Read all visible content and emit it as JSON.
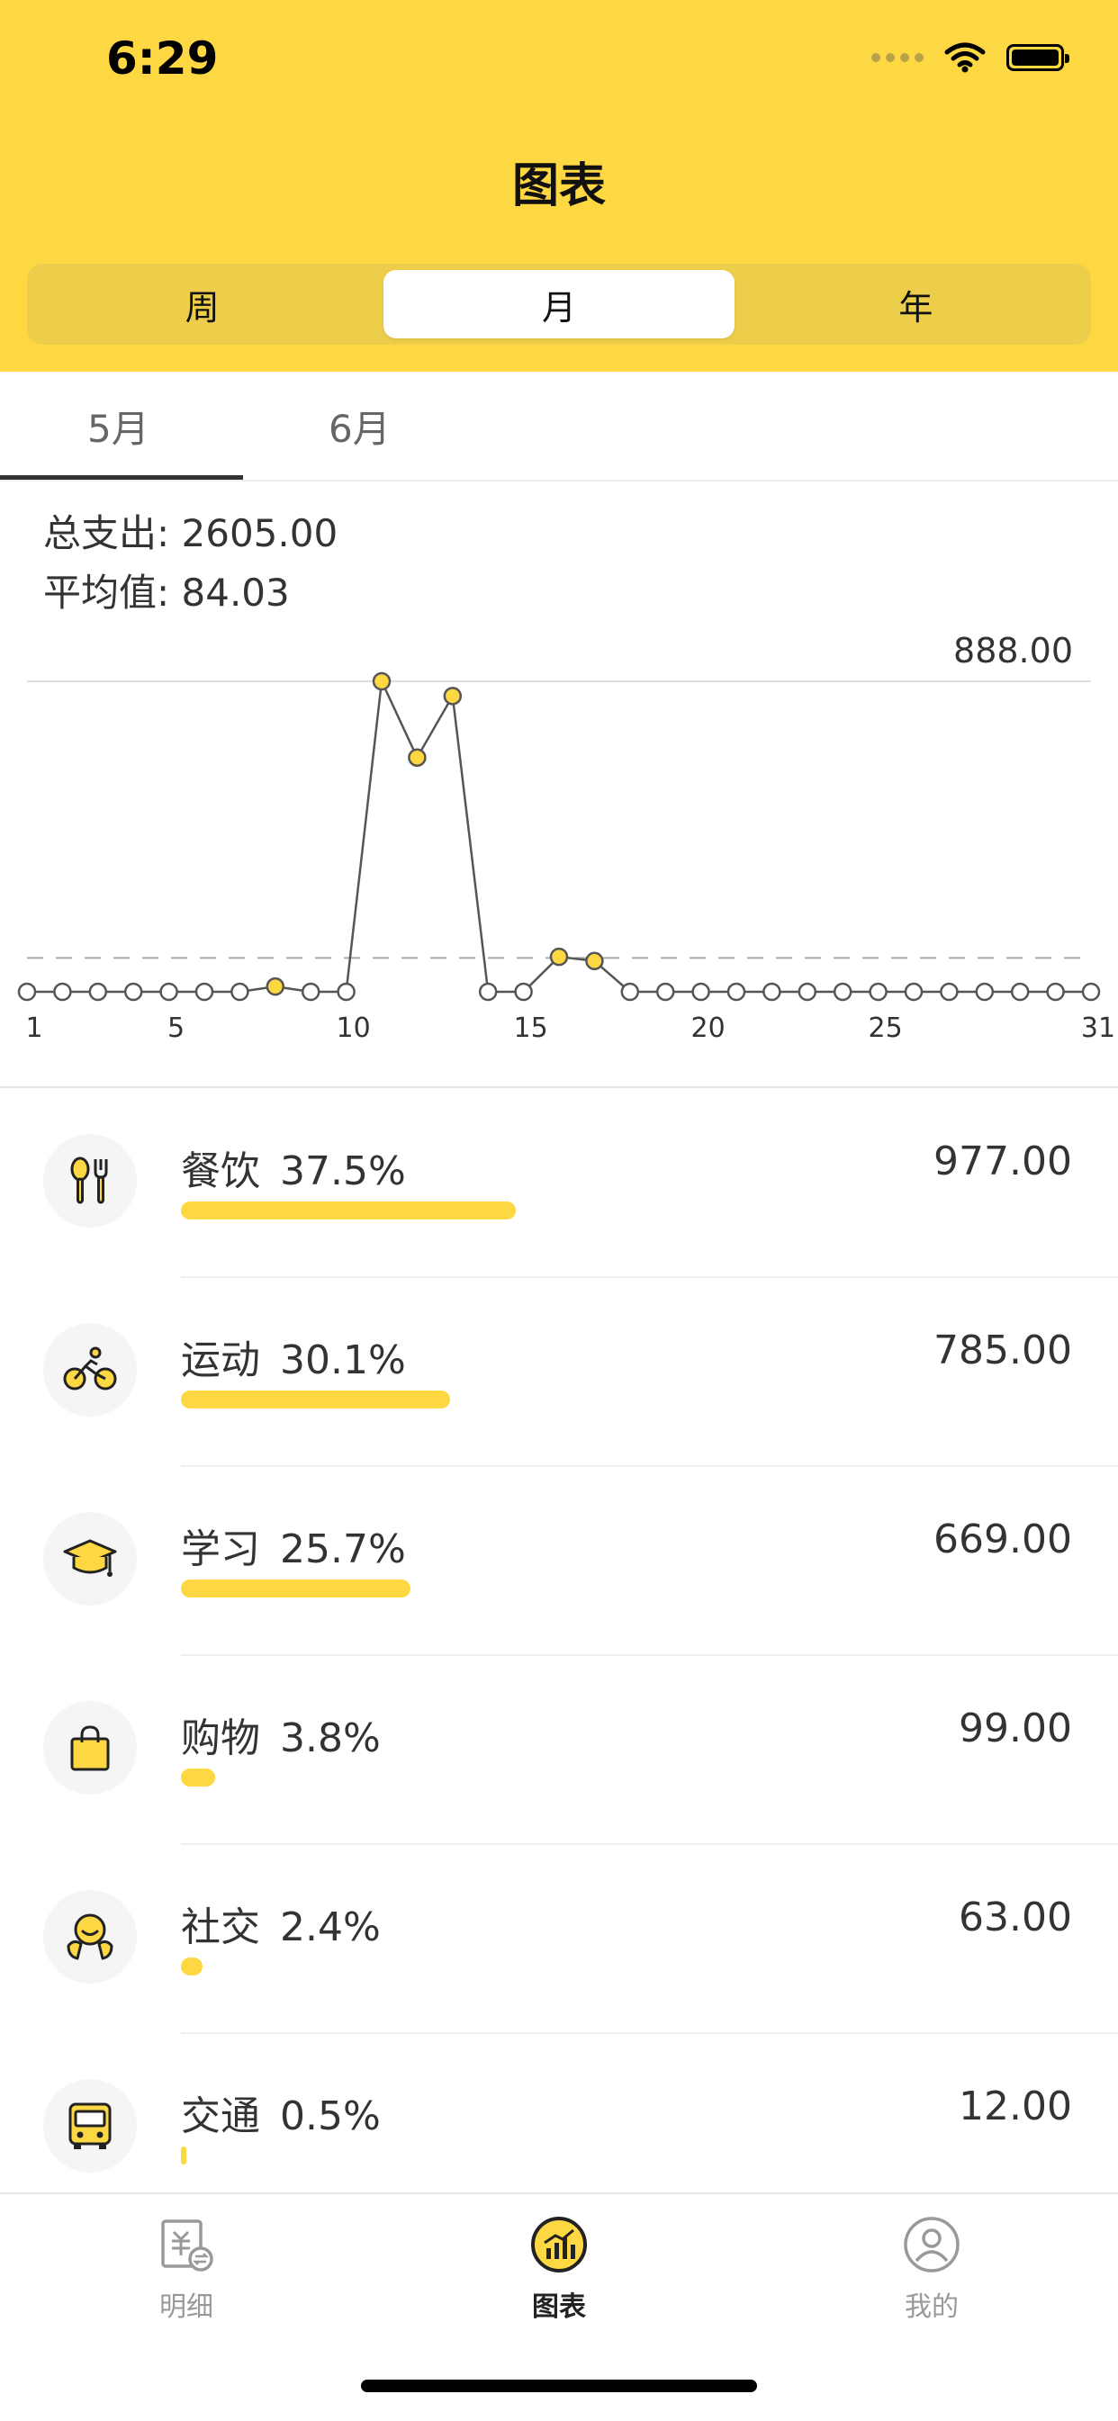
{
  "status": {
    "time": "6:29"
  },
  "header": {
    "title": "图表"
  },
  "segments": [
    {
      "label": "周"
    },
    {
      "label": "月"
    },
    {
      "label": "年"
    }
  ],
  "month_tabs": [
    {
      "label": "5月"
    },
    {
      "label": "6月"
    }
  ],
  "summary": {
    "total_label": "总支出:",
    "total_value": "2605.00",
    "avg_label": "平均值:",
    "avg_value": "84.03"
  },
  "chart_data": {
    "type": "line",
    "x": [
      1,
      2,
      3,
      4,
      5,
      6,
      7,
      8,
      9,
      10,
      11,
      12,
      13,
      14,
      15,
      16,
      17,
      18,
      19,
      20,
      21,
      22,
      23,
      24,
      25,
      26,
      27,
      28,
      29,
      30,
      31
    ],
    "y": [
      0,
      0,
      0,
      0,
      0,
      0,
      0,
      15,
      0,
      0,
      888,
      670,
      846,
      0,
      0,
      100,
      88,
      0,
      0,
      0,
      0,
      0,
      0,
      0,
      0,
      0,
      0,
      0,
      0,
      0,
      0
    ],
    "x_tick_labels": [
      "1",
      "5",
      "10",
      "15",
      "20",
      "25",
      "31"
    ],
    "max_label": "888.00",
    "average_line": 84.03,
    "ylim": [
      0,
      888
    ],
    "grid": false
  },
  "categories": [
    {
      "name": "餐饮",
      "percent": "37.5%",
      "amount": "977.00",
      "ratio": 0.375,
      "icon": "dining-icon"
    },
    {
      "name": "运动",
      "percent": "30.1%",
      "amount": "785.00",
      "ratio": 0.301,
      "icon": "bicycle-icon"
    },
    {
      "name": "学习",
      "percent": "25.7%",
      "amount": "669.00",
      "ratio": 0.257,
      "icon": "graduation-cap-icon"
    },
    {
      "name": "购物",
      "percent": "3.8%",
      "amount": "99.00",
      "ratio": 0.038,
      "icon": "shopping-bag-icon"
    },
    {
      "name": "社交",
      "percent": "2.4%",
      "amount": "63.00",
      "ratio": 0.024,
      "icon": "social-icon"
    },
    {
      "name": "交通",
      "percent": "0.5%",
      "amount": "12.00",
      "ratio": 0.005,
      "icon": "bus-icon"
    }
  ],
  "tabbar": [
    {
      "label": "明细",
      "icon": "detail-icon"
    },
    {
      "label": "图表",
      "icon": "chart-icon"
    },
    {
      "label": "我的",
      "icon": "profile-icon"
    }
  ],
  "colors": {
    "accent": "#FED843",
    "segment_bg": "#EDCE4B",
    "text": "#333333"
  }
}
